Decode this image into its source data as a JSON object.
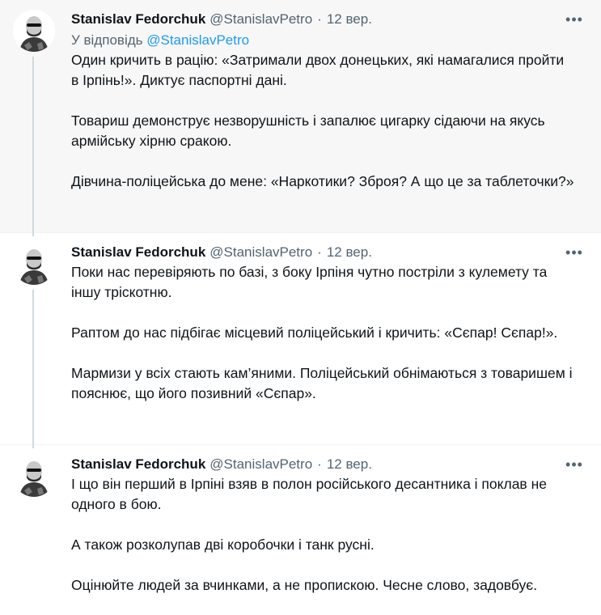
{
  "tweets": [
    {
      "author_name": "Stanislav Fedorchuk",
      "handle": "@StanislavPetro",
      "separator": "·",
      "date": "12 вер.",
      "reply_to_prefix": "У відповідь",
      "reply_to_handle": "@StanislavPetro",
      "more_icon": "more-horizontal-icon",
      "paragraphs": [
        "Один кричить в рацію: «Затримали двох донецьких, які намагалися пройти в Ірпінь!». Диктує паспортні дані.",
        "Товариш демонструє незворушність і запалює цигарку сідаючи на якусь армійську хірню сракою.",
        "Дівчина-поліцейська до мене: «Наркотики? Зброя? А що це за таблеточки?»"
      ]
    },
    {
      "author_name": "Stanislav Fedorchuk",
      "handle": "@StanislavPetro",
      "separator": "·",
      "date": "12 вер.",
      "more_icon": "more-horizontal-icon",
      "paragraphs": [
        "Поки нас перевіряють по базі, з боку Ірпіня чутно постріли з кулемету та іншу тріскотню.",
        "Раптом до нас підбігає місцевий поліцейський і кричить: «Сєпар! Сєпар!».",
        "Мармизи у всіх стають кам’яними. Поліцейський обнімаються з товаришем і пояснює, що його позивний «Сєпар»."
      ]
    },
    {
      "author_name": "Stanislav Fedorchuk",
      "handle": "@StanislavPetro",
      "separator": "·",
      "date": "12 вер.",
      "more_icon": "more-horizontal-icon",
      "paragraphs": [
        "І що він перший в Ірпіні взяв в полон російського десантника і поклав не одного в бою.",
        "А також розколупав дві коробочки і танк русні.",
        "Оцінюйте людей за вчинками, а не пропискою. Чесне слово, задовбує."
      ]
    }
  ],
  "colors": {
    "highlight_bg": "#f7f7f7",
    "text": "#0f1419",
    "secondary": "#536471",
    "link": "#1d9bf0",
    "thread_line": "#cfd9de"
  }
}
